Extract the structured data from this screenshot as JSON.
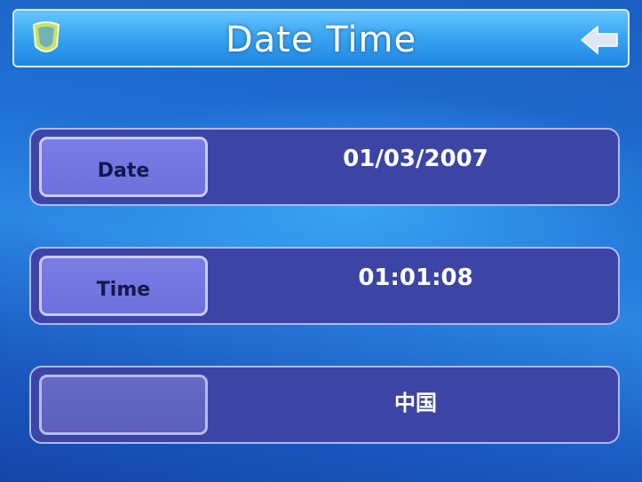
{
  "window": {
    "title": "Date  Time"
  },
  "icons": {
    "app": "shield-icon",
    "back": "back-arrow-icon"
  },
  "rows": [
    {
      "label": "Date",
      "value": "01/03/2007"
    },
    {
      "label": "Time",
      "value": "01:01:08"
    },
    {
      "label": "",
      "value": "中国"
    }
  ],
  "colors": {
    "accent": "#3aa6f3",
    "row_bg": "#3c45a6",
    "button": "#6d70dc"
  }
}
